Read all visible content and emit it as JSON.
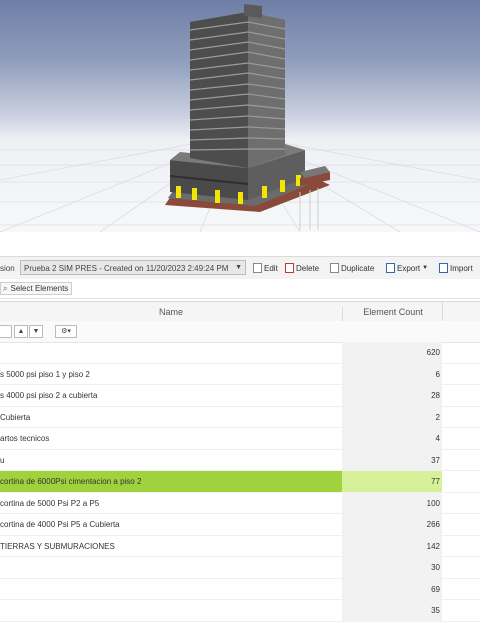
{
  "toolbar": {
    "version_label": "sion",
    "version_value": "Prueba 2 SIM PRES - Created on 11/20/2023 2:49:24 PM",
    "edit_label": "Edit",
    "delete_label": "Delete",
    "duplicate_label": "Duplicate",
    "export_label": "Export",
    "import_label": "Import"
  },
  "select_elements": {
    "label": "Select Elements"
  },
  "table": {
    "headers": {
      "name": "Name",
      "count": "Element Count"
    },
    "rows": [
      {
        "name": "",
        "count": "620",
        "selected": false
      },
      {
        "name": "s 5000 psi piso 1 y piso 2",
        "count": "6",
        "selected": false
      },
      {
        "name": "s 4000 psi piso 2 a cubierta",
        "count": "28",
        "selected": false
      },
      {
        "name": "Cubierta",
        "count": "2",
        "selected": false
      },
      {
        "name": "artos tecnicos",
        "count": "4",
        "selected": false
      },
      {
        "name": "u",
        "count": "37",
        "selected": false
      },
      {
        "name": "cortina de 6000Psi cimentacion a piso 2",
        "count": "77",
        "selected": true
      },
      {
        "name": "cortina de 5000 Psi P2 a P5",
        "count": "100",
        "selected": false
      },
      {
        "name": "cortina de 4000 Psi P5 a Cubierta",
        "count": "266",
        "selected": false
      },
      {
        "name": "TIERRAS Y SUBMURACIONES",
        "count": "142",
        "selected": false
      },
      {
        "name": "",
        "count": "30",
        "selected": false
      },
      {
        "name": "",
        "count": "69",
        "selected": false
      },
      {
        "name": "",
        "count": "35",
        "selected": false
      }
    ]
  },
  "colors": {
    "selected_row": "#9fd23c",
    "selected_count_bg": "#d7f09a",
    "viewport_sky": "#6f7ea6",
    "toolbar_bg": "#f3f3f3"
  },
  "icons": [
    "edit-icon",
    "delete-icon",
    "duplicate-icon",
    "export-icon",
    "import-icon",
    "select-elements-icon",
    "gear-icon",
    "chevron-down-icon"
  ]
}
